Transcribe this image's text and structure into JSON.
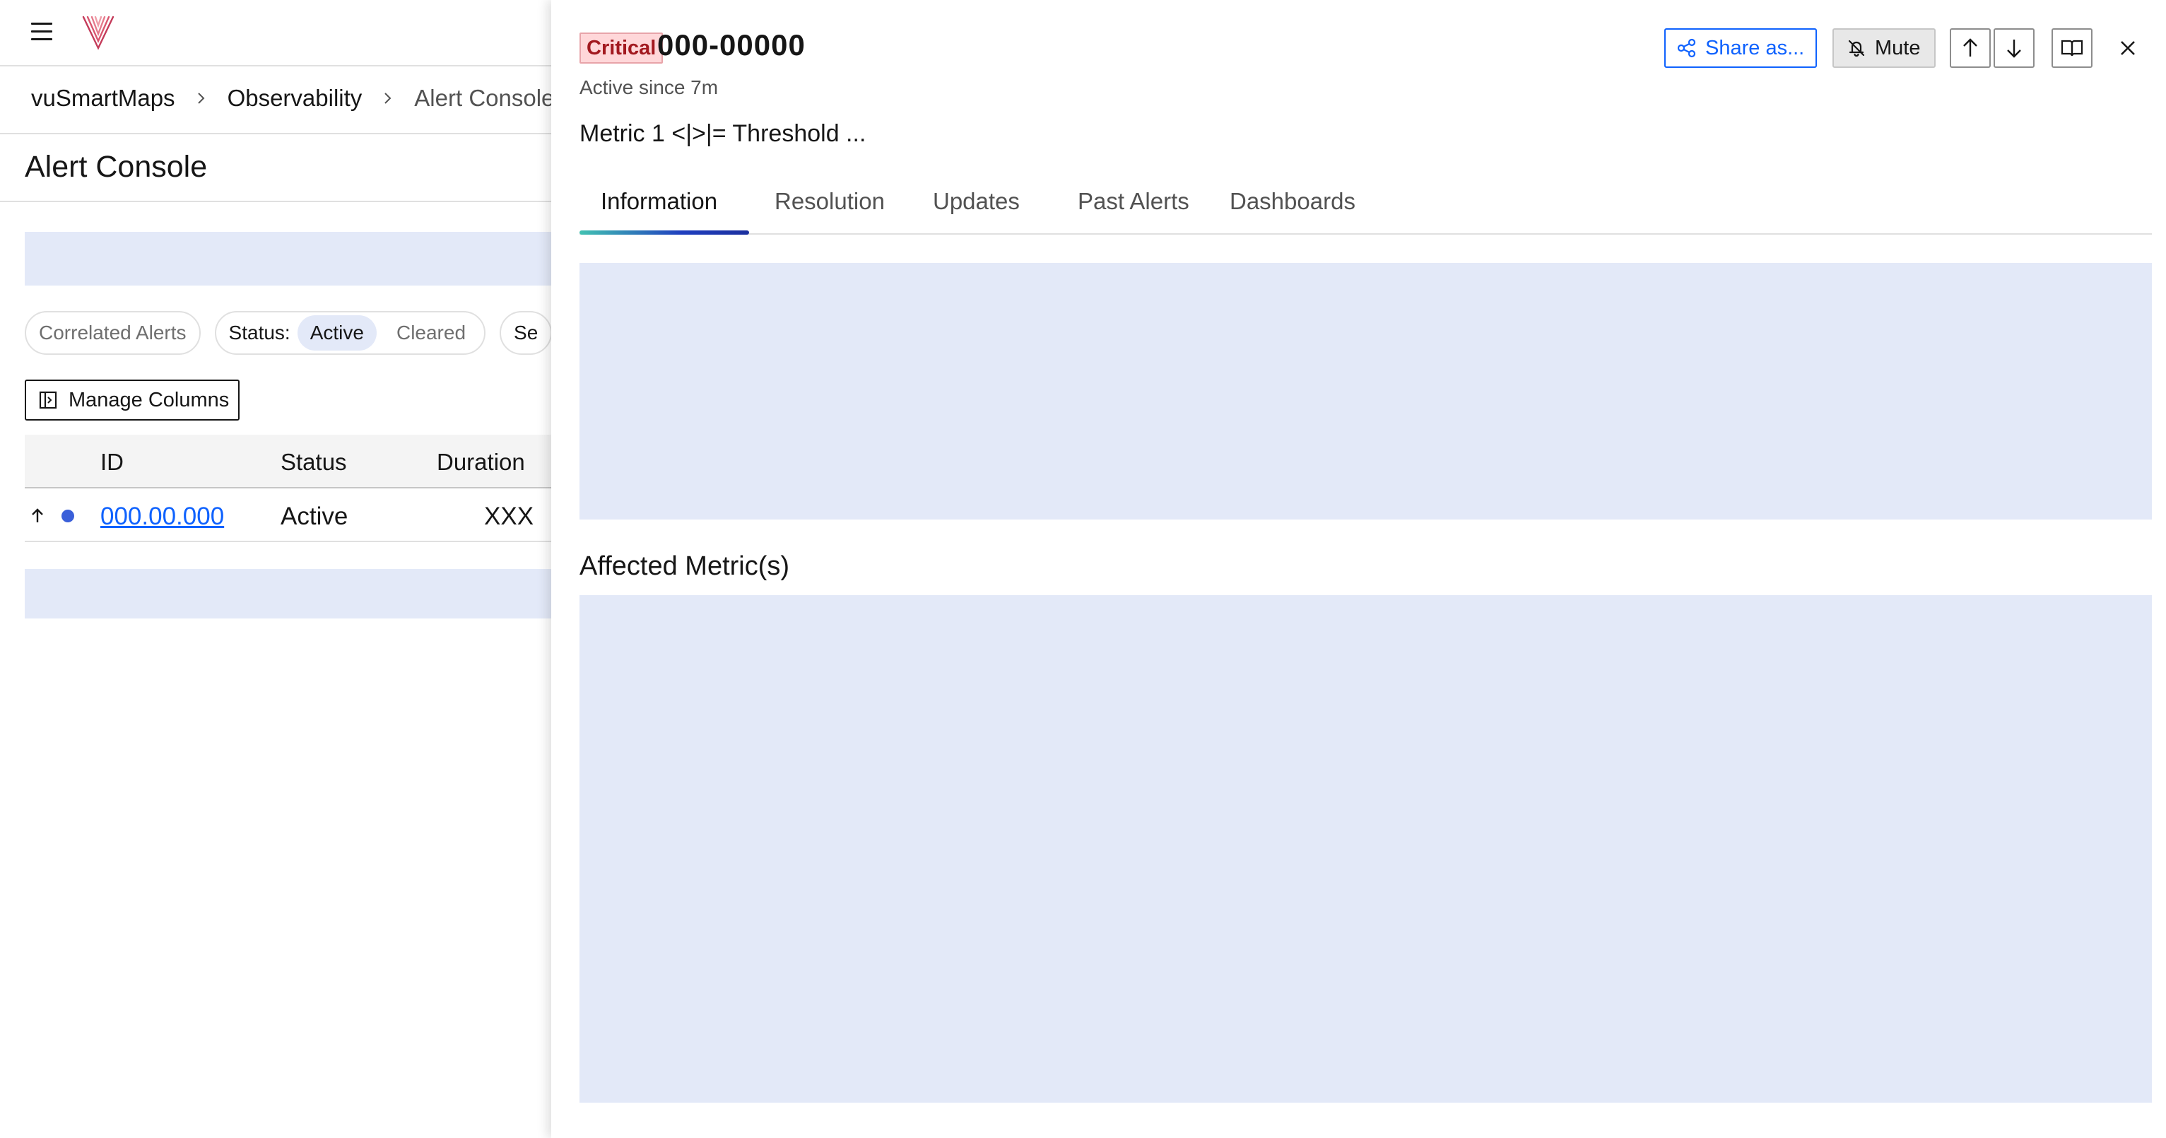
{
  "app": {
    "breadcrumb": [
      "vuSmartMaps",
      "Observability",
      "Alert Console"
    ],
    "page_title": "Alert Console"
  },
  "filters": {
    "correlated": "Correlated Alerts",
    "status_label": "Status:",
    "status_options": [
      "Active",
      "Cleared"
    ],
    "status_selected": "Active",
    "next_chip_partial": "Se"
  },
  "manage_columns": "Manage Columns",
  "table": {
    "columns": [
      "ID",
      "Status",
      "Duration"
    ],
    "rows": [
      {
        "id": "000.00.000",
        "status": "Active",
        "duration": "XXX"
      }
    ]
  },
  "detail": {
    "severity": "Critical",
    "alert_id": "000-00000",
    "active_since": "Active since 7m",
    "description": "Metric 1 <|>|= Threshold ...",
    "actions": {
      "share": "Share as...",
      "mute": "Mute"
    },
    "tabs": [
      "Information",
      "Resolution",
      "Updates",
      "Past Alerts",
      "Dashboards"
    ],
    "selected_tab": "Information",
    "affected_metrics_title": "Affected Metric(s)"
  },
  "colors": {
    "accent": "#0f62fe",
    "critical_bg": "#ffd7d9",
    "critical_text": "#a2191f",
    "skeleton": "#e3e9f8",
    "status_dot": "#3a5fd9"
  },
  "icons": [
    "menu-icon",
    "logo-icon",
    "chevron-right-icon",
    "columns-icon",
    "sort-arrow-up-icon",
    "share-icon",
    "bell-off-icon",
    "arrow-up-icon",
    "arrow-down-icon",
    "book-icon",
    "close-icon"
  ]
}
